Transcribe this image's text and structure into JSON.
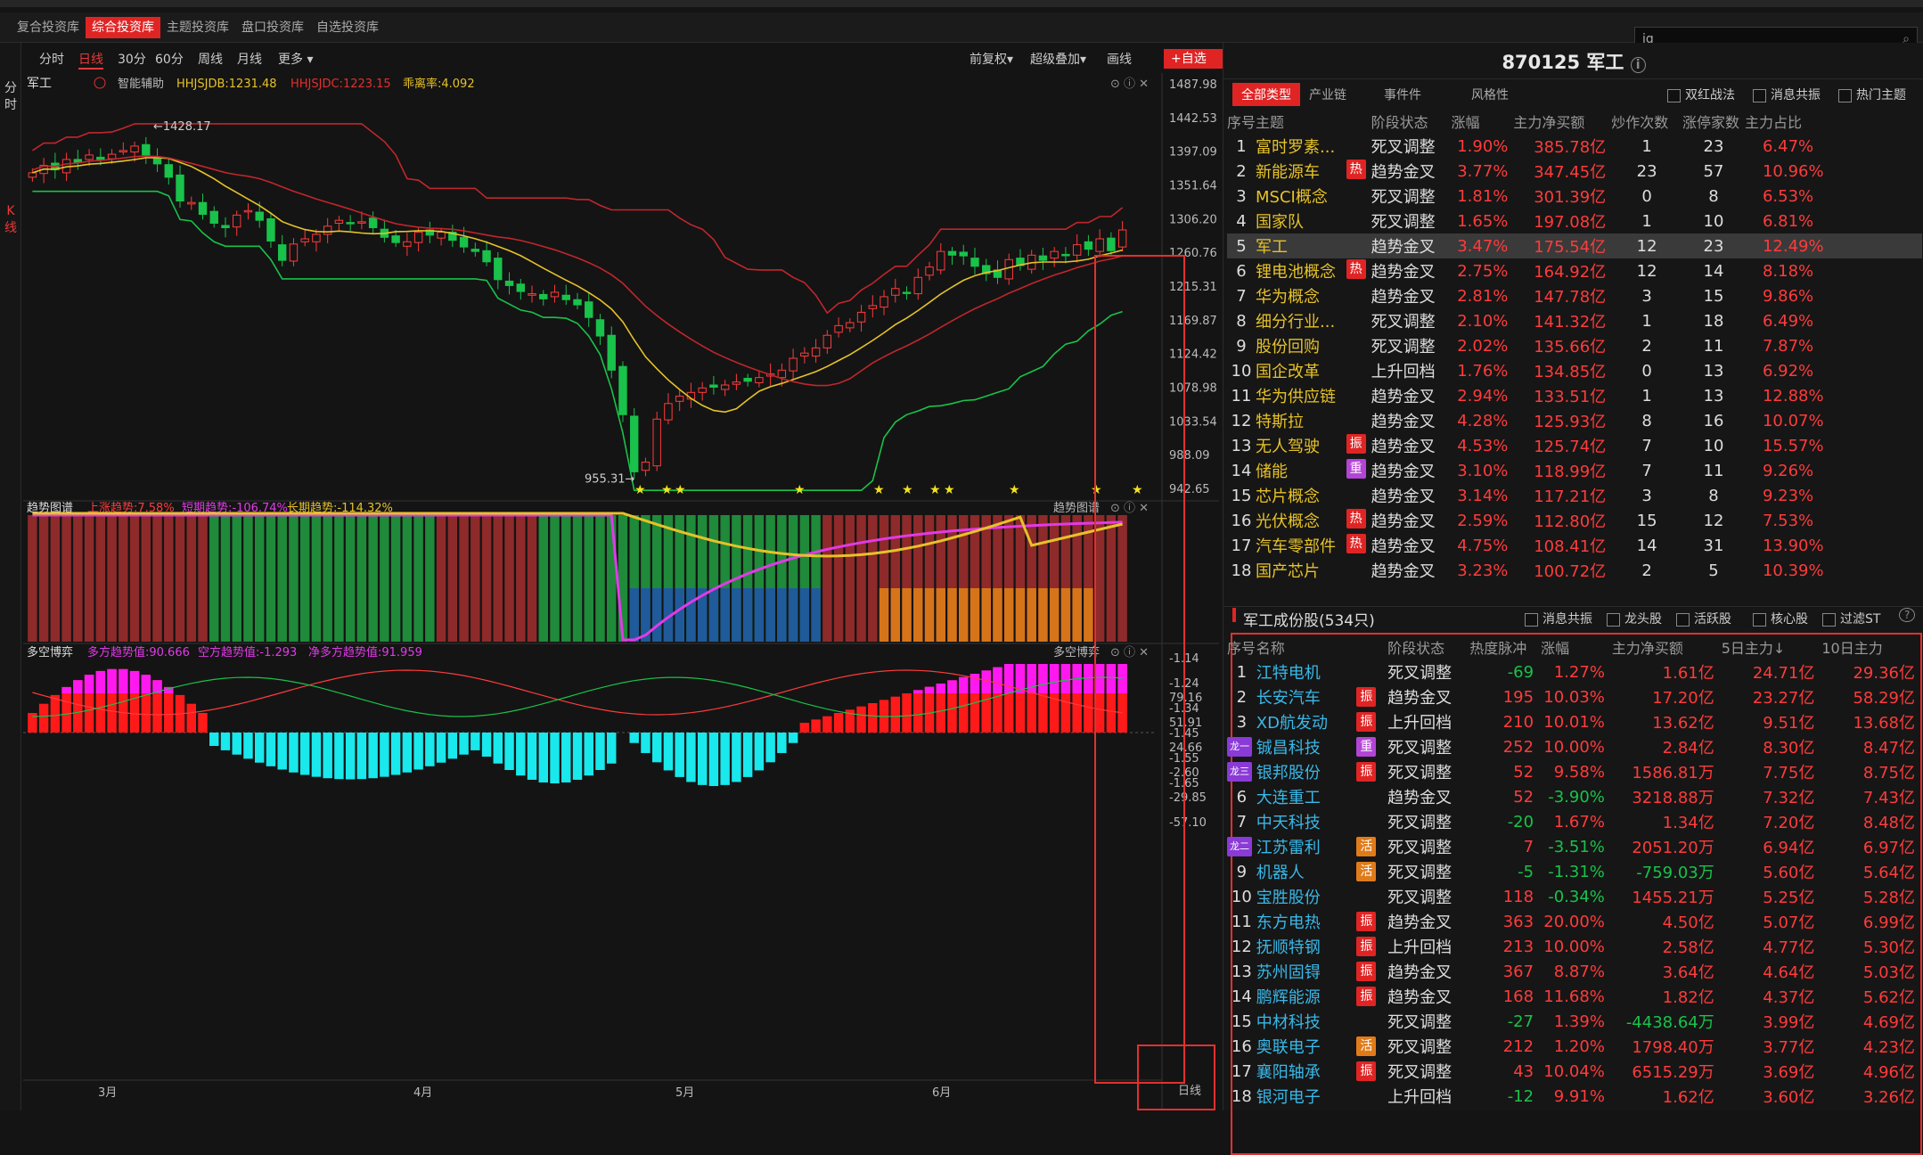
{
  "subtabs": [
    "复合投资库",
    "综合投资库",
    "主题投资库",
    "盘口投资库",
    "自选投资库"
  ],
  "active_subtab": 1,
  "search": {
    "value": "jg"
  },
  "leftnav": {
    "intraday": "分时",
    "kline": "K线"
  },
  "toolbar": {
    "periods": [
      "分时",
      "日线",
      "30分",
      "60分",
      "周线",
      "月线",
      "更多 ▾"
    ],
    "active_period": 1,
    "adjust": "前复权▾",
    "overlay": "超级叠加▾",
    "draw": "画线",
    "add_watch": "+自选"
  },
  "main_legend": {
    "name": "军工",
    "assist": "智能辅助",
    "hhjsjdb": "HHJSJDB:1231.48",
    "hhjsjdc": "HHJSJDC:1223.15",
    "ratio": "乖离率:4.092"
  },
  "price_labels": [
    "1487.98",
    "1442.53",
    "1397.09",
    "1351.64",
    "1306.20",
    "1260.76",
    "1215.31",
    "1169.87",
    "1124.42",
    "1078.98",
    "1033.54",
    "988.09",
    "942.65"
  ],
  "annotations": {
    "high": "1428.17",
    "low": "955.31"
  },
  "trend_legend": {
    "title": "趋势图谱",
    "up": "上涨趋势:7.58%",
    "short": "短期趋势:-106.74%",
    "long": "长期趋势:-114.32%",
    "right": "趋势图谱"
  },
  "trend_labels": [
    "-1.14",
    "-1.24",
    "-1.34",
    "-1.45",
    "-1.55",
    "-1.65"
  ],
  "bull_legend": {
    "title": "多空博弈",
    "bull": "多方趋势值:90.666",
    "bear": "空方趋势值:-1.293",
    "net": "净多方趋势值:91.959",
    "right": "多空博弈"
  },
  "bull_labels": [
    "79.16",
    "51.91",
    "24.66",
    "-2.60",
    "-29.85",
    "-57.10"
  ],
  "months": [
    "3月",
    "4月",
    "5月",
    "6月"
  ],
  "period_tag": "日线",
  "colors": {
    "up": "#ff3b3b",
    "down": "#19c24a",
    "accent": "#e02424",
    "yellow": "#e6c229",
    "magenta": "#e23ae8",
    "cyan": "#19e8ec"
  },
  "right": {
    "title": "870125 军工",
    "tabs": [
      "全部类型",
      "产业链",
      "事件件",
      "风格性"
    ],
    "checks": [
      "双红战法",
      "消息共振",
      "热门主题"
    ],
    "topic_headers": [
      "序号",
      "主题",
      "阶段状态",
      "涨幅",
      "主力净买额",
      "炒作次数",
      "涨停家数",
      "主力占比"
    ],
    "topics": [
      [
        "1",
        "富时罗素...",
        "",
        "死叉调整",
        "1.90%",
        "385.78亿",
        "1",
        "23",
        "6.47%"
      ],
      [
        "2",
        "新能源车",
        "热",
        "趋势金叉",
        "3.77%",
        "347.45亿",
        "23",
        "57",
        "10.96%"
      ],
      [
        "3",
        "MSCI概念",
        "",
        "死叉调整",
        "1.81%",
        "301.39亿",
        "0",
        "8",
        "6.53%"
      ],
      [
        "4",
        "国家队",
        "",
        "死叉调整",
        "1.65%",
        "197.08亿",
        "1",
        "10",
        "6.81%"
      ],
      [
        "5",
        "军工",
        "",
        "趋势金叉",
        "3.47%",
        "175.54亿",
        "12",
        "23",
        "12.49%"
      ],
      [
        "6",
        "锂电池概念",
        "热",
        "趋势金叉",
        "2.75%",
        "164.92亿",
        "12",
        "14",
        "8.18%"
      ],
      [
        "7",
        "华为概念",
        "",
        "趋势金叉",
        "2.81%",
        "147.78亿",
        "3",
        "15",
        "9.86%"
      ],
      [
        "8",
        "细分行业...",
        "",
        "死叉调整",
        "2.10%",
        "141.32亿",
        "1",
        "18",
        "6.49%"
      ],
      [
        "9",
        "股份回购",
        "",
        "死叉调整",
        "2.02%",
        "135.66亿",
        "2",
        "11",
        "7.87%"
      ],
      [
        "10",
        "国企改革",
        "",
        "上升回档",
        "1.76%",
        "134.85亿",
        "0",
        "13",
        "6.92%"
      ],
      [
        "11",
        "华为供应链",
        "",
        "趋势金叉",
        "2.94%",
        "133.51亿",
        "1",
        "13",
        "12.88%"
      ],
      [
        "12",
        "特斯拉",
        "",
        "趋势金叉",
        "4.28%",
        "125.93亿",
        "8",
        "16",
        "10.07%"
      ],
      [
        "13",
        "无人驾驶",
        "振",
        "趋势金叉",
        "4.53%",
        "125.74亿",
        "7",
        "10",
        "15.57%"
      ],
      [
        "14",
        "储能",
        "重",
        "趋势金叉",
        "3.10%",
        "118.99亿",
        "7",
        "11",
        "9.26%"
      ],
      [
        "15",
        "芯片概念",
        "",
        "趋势金叉",
        "3.14%",
        "117.21亿",
        "3",
        "8",
        "9.23%"
      ],
      [
        "16",
        "光伏概念",
        "热",
        "趋势金叉",
        "2.59%",
        "112.80亿",
        "15",
        "12",
        "7.53%"
      ],
      [
        "17",
        "汽车零部件",
        "热",
        "趋势金叉",
        "4.75%",
        "108.41亿",
        "14",
        "31",
        "13.90%"
      ],
      [
        "18",
        "国产芯片",
        "",
        "趋势金叉",
        "3.23%",
        "100.72亿",
        "2",
        "5",
        "10.39%"
      ]
    ],
    "stocks_title": "军工成份股(534只)",
    "stock_checks": [
      "消息共振",
      "龙头股",
      "活跃股",
      "核心股",
      "过滤ST"
    ],
    "stock_headers": [
      "序号",
      "名称",
      "阶段状态",
      "热度脉冲",
      "涨幅",
      "主力净买额",
      "5日主力↓",
      "10日主力"
    ],
    "stocks": [
      [
        "",
        "1",
        "江特电机",
        "",
        "死叉调整",
        "-69",
        "1.27%",
        "1.61亿",
        "24.71亿",
        "29.36亿"
      ],
      [
        "",
        "2",
        "长安汽车",
        "振",
        "趋势金叉",
        "195",
        "10.03%",
        "17.20亿",
        "23.27亿",
        "58.29亿"
      ],
      [
        "",
        "3",
        "XD航发动",
        "振",
        "上升回档",
        "210",
        "10.01%",
        "13.62亿",
        "9.51亿",
        "13.68亿"
      ],
      [
        "龙一",
        "4",
        "铖昌科技",
        "重",
        "死叉调整",
        "252",
        "10.00%",
        "2.84亿",
        "8.30亿",
        "8.47亿"
      ],
      [
        "龙三",
        "5",
        "银邦股份",
        "振",
        "死叉调整",
        "52",
        "9.58%",
        "1586.81万",
        "7.75亿",
        "8.75亿"
      ],
      [
        "",
        "6",
        "大连重工",
        "",
        "趋势金叉",
        "52",
        "-3.90%",
        "3218.88万",
        "7.32亿",
        "7.43亿"
      ],
      [
        "",
        "7",
        "中天科技",
        "",
        "死叉调整",
        "-20",
        "1.67%",
        "1.34亿",
        "7.20亿",
        "8.48亿"
      ],
      [
        "龙二",
        "8",
        "江苏雷利",
        "活",
        "死叉调整",
        "7",
        "-3.51%",
        "2051.20万",
        "6.94亿",
        "6.97亿"
      ],
      [
        "",
        "9",
        "机器人",
        "活",
        "死叉调整",
        "-5",
        "-1.31%",
        "-759.03万",
        "5.60亿",
        "5.64亿"
      ],
      [
        "",
        "10",
        "宝胜股份",
        "",
        "死叉调整",
        "118",
        "-0.34%",
        "1455.21万",
        "5.25亿",
        "5.28亿"
      ],
      [
        "",
        "11",
        "东方电热",
        "振",
        "趋势金叉",
        "363",
        "20.00%",
        "4.50亿",
        "5.07亿",
        "6.99亿"
      ],
      [
        "",
        "12",
        "抚顺特钢",
        "振",
        "上升回档",
        "213",
        "10.00%",
        "2.58亿",
        "4.77亿",
        "5.30亿"
      ],
      [
        "",
        "13",
        "苏州固锝",
        "振",
        "趋势金叉",
        "367",
        "8.87%",
        "3.64亿",
        "4.64亿",
        "5.03亿"
      ],
      [
        "",
        "14",
        "鹏辉能源",
        "振",
        "趋势金叉",
        "168",
        "11.68%",
        "1.82亿",
        "4.37亿",
        "5.62亿"
      ],
      [
        "",
        "15",
        "中材科技",
        "",
        "死叉调整",
        "-27",
        "1.39%",
        "-4438.64万",
        "3.99亿",
        "4.69亿"
      ],
      [
        "",
        "16",
        "奥联电子",
        "活",
        "死叉调整",
        "212",
        "1.20%",
        "1798.40万",
        "3.77亿",
        "4.23亿"
      ],
      [
        "",
        "17",
        "襄阳轴承",
        "振",
        "死叉调整",
        "43",
        "10.04%",
        "6515.29万",
        "3.69亿",
        "4.96亿"
      ],
      [
        "",
        "18",
        "银河电子",
        "",
        "上升回档",
        "-12",
        "9.91%",
        "1.62亿",
        "3.60亿",
        "3.26亿"
      ]
    ]
  }
}
